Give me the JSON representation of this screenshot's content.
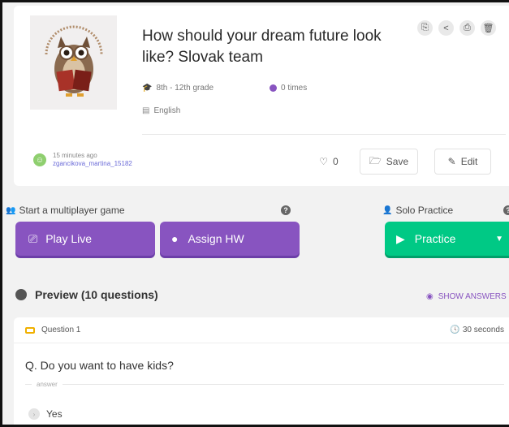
{
  "quiz": {
    "title": "How should your dream future look like? Slovak team",
    "grade": "8th - 12th grade",
    "plays": "0 times",
    "language": "English",
    "author_time": "15 minutes ago",
    "author_name": "zgancikova_martina_15182",
    "likes": "0",
    "save_label": "Save",
    "edit_label": "Edit",
    "image_text": "ZÁKLADNÁ ŠKOLA MICHALA TIBENSKÉHO"
  },
  "play": {
    "multiplayer_label": "Start a multiplayer game",
    "solo_label": "Solo Practice",
    "play_live_label": "Play Live",
    "assign_hw_label": "Assign HW",
    "practice_label": "Practice"
  },
  "preview": {
    "heading": "Preview (10 questions)",
    "show_answers": "SHOW ANSWERS"
  },
  "question": {
    "label": "Question 1",
    "time": "30 seconds",
    "text": "Q. Do you want to have kids?",
    "answer_label": "answer",
    "options": [
      "Yes"
    ]
  },
  "colors": {
    "accent_purple": "#8854c0",
    "practice_green": "#00c985",
    "question_icon": "#f0b000"
  }
}
